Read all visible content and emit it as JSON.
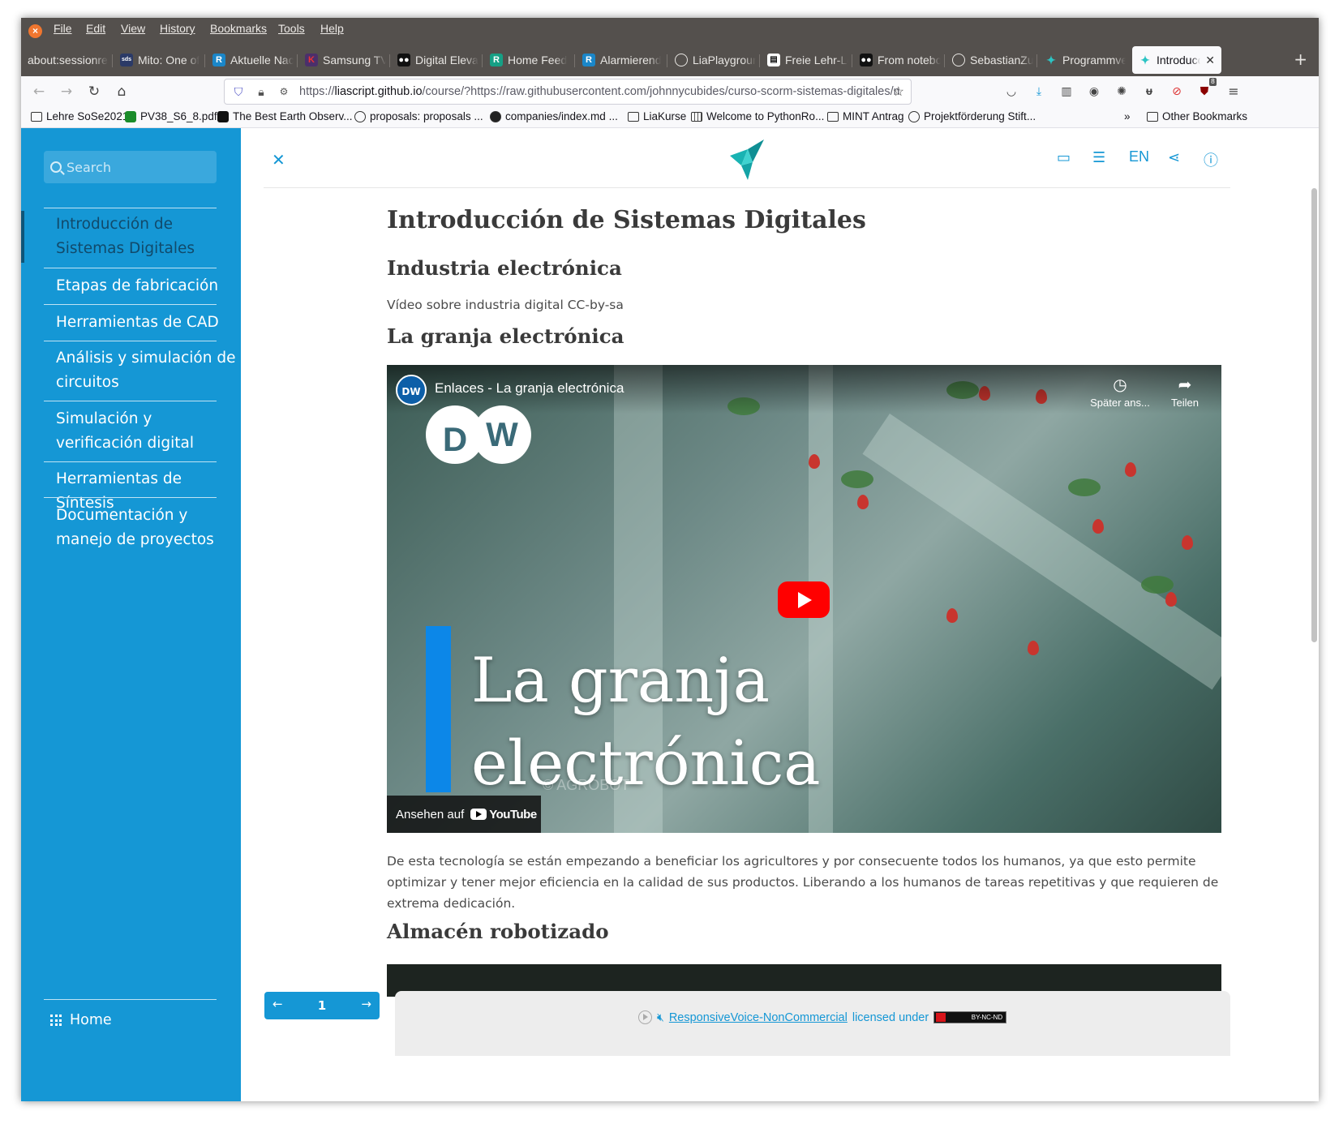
{
  "browser": {
    "menu": [
      "File",
      "Edit",
      "View",
      "History",
      "Bookmarks",
      "Tools",
      "Help"
    ],
    "tabs": [
      {
        "label": "about:sessionrestore",
        "icon": "blank-icon"
      },
      {
        "label": "Mito: One of",
        "icon": "sds-icon"
      },
      {
        "label": "Aktuelle Nac",
        "icon": "r-icon"
      },
      {
        "label": "Samsung TV",
        "icon": "k-icon"
      },
      {
        "label": "Digital Elevat",
        "icon": "medium-icon"
      },
      {
        "label": "Home Feed",
        "icon": "r-green-icon"
      },
      {
        "label": "Alarmierend",
        "icon": "r-icon"
      },
      {
        "label": "LiaPlaygroun",
        "icon": "github-icon"
      },
      {
        "label": "Freie Lehr-Le",
        "icon": "doc-icon"
      },
      {
        "label": "From notebo",
        "icon": "medium-icon"
      },
      {
        "label": "SebastianZu",
        "icon": "github-icon"
      },
      {
        "label": "Programmve",
        "icon": "liascript-icon"
      },
      {
        "label": "Introducci",
        "icon": "liascript-icon",
        "active": true
      }
    ],
    "url_prefix": "https://",
    "url_host": "liascript.github.io",
    "url_rest": "/course/?https://raw.githubusercontent.com/johnnycubides/curso-scorm-sistemas-digitales/m",
    "bookmarks": [
      {
        "label": "Lehre SoSe2021",
        "icon": "folder-icon"
      },
      {
        "label": "PV38_S6_8.pdf",
        "icon": "chess-icon"
      },
      {
        "label": "The Best Earth Observ...",
        "icon": "medium-icon"
      },
      {
        "label": "proposals: proposals ...",
        "icon": "globe-icon"
      },
      {
        "label": "companies/index.md ...",
        "icon": "github-icon"
      },
      {
        "label": "LiaKurse",
        "icon": "folder-icon"
      },
      {
        "label": "Welcome to PythonRo...",
        "icon": "page-icon"
      },
      {
        "label": "MINT Antrag",
        "icon": "folder-icon"
      },
      {
        "label": "Projektförderung Stift...",
        "icon": "globe-icon"
      }
    ],
    "other_bookmarks": "Other Bookmarks",
    "ublock_badge": "8"
  },
  "sidebar": {
    "search_placeholder": "Search",
    "items": [
      {
        "label": "Introducción de Sistemas Digitales",
        "active": true
      },
      {
        "label": "Etapas de fabricación"
      },
      {
        "label": "Herramientas de CAD"
      },
      {
        "label": "Análisis y simulación de circuitos"
      },
      {
        "label": "Simulación y verificación digital"
      },
      {
        "label": "Herramientas de Síntesis"
      },
      {
        "label": "Documentación y manejo de proyectos"
      }
    ],
    "home": "Home"
  },
  "header": {
    "lang": "EN"
  },
  "article": {
    "title": "Introducción de Sistemas Digitales",
    "h2_1": "Industria electrónica",
    "p1": "Vídeo sobre industria digital CC-by-sa",
    "h2_2": "La granja electrónica",
    "video": {
      "channel": "DW",
      "title": "Enlaces - La granja electrónica",
      "watch_later": "Später ans...",
      "share": "Teilen",
      "overlay_line1": "La granja",
      "overlay_line2": "electrónica",
      "watch_on": "Ansehen auf",
      "youtube": "YouTube",
      "watermark": "© AGROBOT"
    },
    "p2": "De esta tecnología se están empezando a beneficiar los agricultores y por consecuente todos los humanos, ya que esto permite optimizar y tener mejor eficiencia en la calidad de sus productos. Liberando a los humanos de tareas repetitivas y que requieren de extrema dedicación.",
    "h2_3": "Almacén robotizado"
  },
  "footer": {
    "page": "1",
    "voice_link": "ResponsiveVoice-NonCommercial",
    "licensed": "licensed under",
    "license_badge": "BY-NC-ND"
  },
  "colors": {
    "accent": "#1597d5",
    "sidebar_active_text": "#114a6b",
    "youtube_red": "#ff0000",
    "dw_blue": "#0c87e8"
  }
}
